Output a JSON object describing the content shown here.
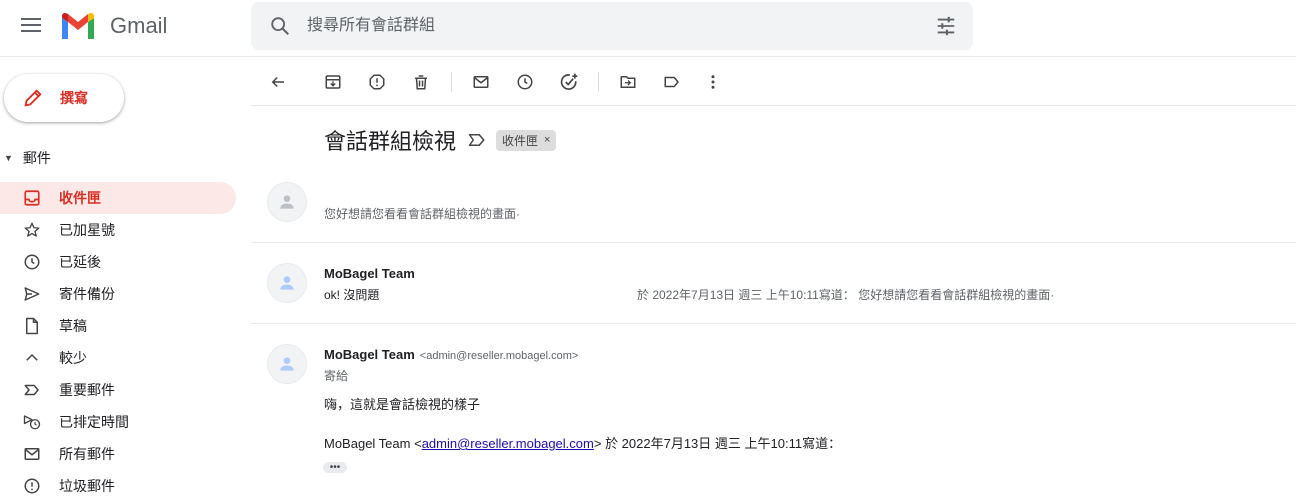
{
  "app": {
    "name": "Gmail"
  },
  "search": {
    "placeholder": "搜尋所有會話群組"
  },
  "sidebar": {
    "compose_label": "撰寫",
    "section_label": "郵件",
    "items": [
      {
        "label": "收件匣",
        "icon": "inbox-icon",
        "active": true
      },
      {
        "label": "已加星號",
        "icon": "star-icon"
      },
      {
        "label": "已延後",
        "icon": "clock-icon"
      },
      {
        "label": "寄件備份",
        "icon": "send-icon"
      },
      {
        "label": "草稿",
        "icon": "draft-icon"
      },
      {
        "label": "較少",
        "icon": "chevron-up-icon"
      },
      {
        "label": "重要郵件",
        "icon": "important-icon"
      },
      {
        "label": "已排定時間",
        "icon": "scheduled-icon"
      },
      {
        "label": "所有郵件",
        "icon": "mail-icon"
      },
      {
        "label": "垃圾郵件",
        "icon": "spam-icon"
      }
    ]
  },
  "toolbar": {
    "buttons": [
      "back-icon",
      "archive-icon",
      "report-spam-icon",
      "delete-icon",
      "mark-unread-icon",
      "snooze-icon",
      "add-task-icon",
      "move-to-icon",
      "label-icon",
      "more-vert-icon"
    ]
  },
  "thread": {
    "subject": "會話群組檢視",
    "label_chip": "收件匣",
    "label_chip_close": "×",
    "messages": [
      {
        "snippet": "您好想請您看看會話群組檢視的畫面·"
      },
      {
        "sender": "MoBagel Team",
        "preview": "ok! 沒問題",
        "quote_preview": "於 2022年7月13日 週三 上午10:11寫道： 您好想請您看看會話群組檢視的畫面·"
      },
      {
        "sender": "MoBagel Team",
        "email": "<admin@reseller.mobagel.com>",
        "to_label": "寄給",
        "body": "嗨，這就是會話檢視的樣子",
        "quote_prefix": "MoBagel Team <",
        "quote_link": "admin@reseller.mobagel.com",
        "quote_suffix": "> 於 2022年7月13日 週三 上午10:11寫道：",
        "ellipsis": "•••"
      }
    ]
  },
  "colors": {
    "accent": "#d93025",
    "active_bg": "#fce8e6",
    "link": "#1a0dab"
  }
}
